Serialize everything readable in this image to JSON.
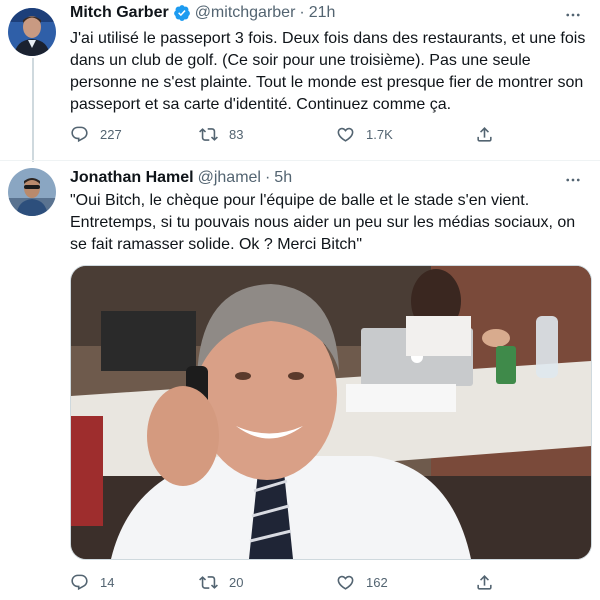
{
  "tweets": [
    {
      "display_name": "Mitch Garber",
      "handle": "@mitchgarber",
      "separator": "·",
      "time": "21h",
      "verified": true,
      "text": "J'ai utilisé le passeport 3 fois. Deux fois dans des restaurants, et une fois dans un club de golf. (Ce soir pour une troisième). Pas une seule personne ne s'est plainte. Tout le monde est presque fier de montrer son passeport et sa carte d'identité. Continuez comme ça.",
      "stats": {
        "replies": "227",
        "retweets": "83",
        "likes": "1.7K"
      }
    },
    {
      "display_name": "Jonathan Hamel",
      "handle": "@jhamel",
      "separator": "·",
      "time": "5h",
      "verified": false,
      "text": "\"Oui Bitch, le chèque pour l'équipe de balle et le stade s'en vient. Entretemps, si tu pouvais nous aider un peu sur les médias sociaux, on se fait ramasser solide. Ok ? Merci Bitch\"",
      "stats": {
        "replies": "14",
        "retweets": "20",
        "likes": "162"
      }
    }
  ],
  "icons": {
    "reply": "reply-icon",
    "retweet": "retweet-icon",
    "like": "heart-icon",
    "share": "share-icon",
    "more": "more-icon",
    "verified": "verified-badge-icon"
  },
  "colors": {
    "text": "#0f1419",
    "secondary": "#536471",
    "verified": "#1d9bf0",
    "divider": "#eff3f4"
  }
}
